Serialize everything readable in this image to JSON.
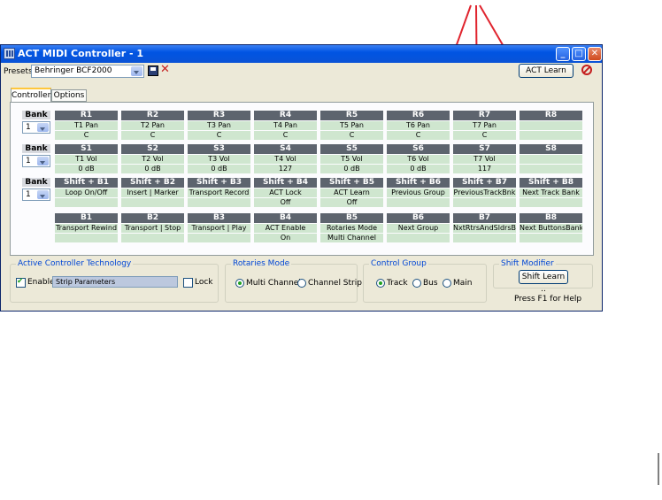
{
  "window": {
    "title": "ACT MIDI Controller - 1"
  },
  "presets": {
    "label": "Presets:",
    "value": "Behringer BCF2000"
  },
  "act_learn_label": "ACT Learn",
  "tabs": [
    "Controllers",
    "Options"
  ],
  "bank_label": "Bank",
  "rows": [
    {
      "bank_value": "1",
      "cells": [
        {
          "head": "R1",
          "l1": "T1 Pan",
          "l2": "C"
        },
        {
          "head": "R2",
          "l1": "T2 Pan",
          "l2": "C"
        },
        {
          "head": "R3",
          "l1": "T3 Pan",
          "l2": "C"
        },
        {
          "head": "R4",
          "l1": "T4 Pan",
          "l2": "C"
        },
        {
          "head": "R5",
          "l1": "T5 Pan",
          "l2": "C"
        },
        {
          "head": "R6",
          "l1": "T6 Pan",
          "l2": "C"
        },
        {
          "head": "R7",
          "l1": "T7 Pan",
          "l2": "C"
        },
        {
          "head": "R8",
          "l1": "",
          "l2": ""
        }
      ]
    },
    {
      "bank_value": "1",
      "cells": [
        {
          "head": "S1",
          "l1": "T1 Vol",
          "l2": "0 dB"
        },
        {
          "head": "S2",
          "l1": "T2 Vol",
          "l2": "0 dB"
        },
        {
          "head": "S3",
          "l1": "T3 Vol",
          "l2": "0 dB"
        },
        {
          "head": "S4",
          "l1": "T4 Vol",
          "l2": "127"
        },
        {
          "head": "S5",
          "l1": "T5 Vol",
          "l2": "0 dB"
        },
        {
          "head": "S6",
          "l1": "T6 Vol",
          "l2": "0 dB"
        },
        {
          "head": "S7",
          "l1": "T7 Vol",
          "l2": "117"
        },
        {
          "head": "S8",
          "l1": "",
          "l2": ""
        }
      ]
    },
    {
      "bank_value": "1",
      "cells": [
        {
          "head": "Shift + B1",
          "l1": "Loop On/Off",
          "l2": ""
        },
        {
          "head": "Shift + B2",
          "l1": "Insert | Marker",
          "l2": ""
        },
        {
          "head": "Shift + B3",
          "l1": "Transport Record",
          "l2": ""
        },
        {
          "head": "Shift + B4",
          "l1": "ACT Lock",
          "l2": "Off"
        },
        {
          "head": "Shift + B5",
          "l1": "ACT Learn",
          "l2": "Off"
        },
        {
          "head": "Shift + B6",
          "l1": "Previous Group",
          "l2": ""
        },
        {
          "head": "Shift + B7",
          "l1": "PreviousTrackBnk",
          "l2": ""
        },
        {
          "head": "Shift + B8",
          "l1": "Next Track Bank",
          "l2": ""
        }
      ]
    },
    {
      "bank_value": null,
      "cells": [
        {
          "head": "B1",
          "l1": "Transport Rewind",
          "l2": ""
        },
        {
          "head": "B2",
          "l1": "Transport | Stop",
          "l2": ""
        },
        {
          "head": "B3",
          "l1": "Transport | Play",
          "l2": ""
        },
        {
          "head": "B4",
          "l1": "ACT Enable",
          "l2": "On"
        },
        {
          "head": "B5",
          "l1": "Rotaries Mode",
          "l2": "Multi Channel"
        },
        {
          "head": "B6",
          "l1": "Next Group",
          "l2": ""
        },
        {
          "head": "B7",
          "l1": "NxtRtrsAndSldrsB",
          "l2": ""
        },
        {
          "head": "B8",
          "l1": "Next ButtonsBank",
          "l2": ""
        }
      ]
    }
  ],
  "act_group": {
    "title": "Active Controller Technology",
    "enable_label": "Enable",
    "enable_checked": true,
    "field_value": "Strip Parameters",
    "lock_label": "Lock"
  },
  "rotaries_group": {
    "title": "Rotaries Mode",
    "options": [
      "Multi Channel",
      "Channel Strip"
    ],
    "selected": 0
  },
  "control_group": {
    "title": "Control Group",
    "options": [
      "Track",
      "Bus",
      "Main"
    ],
    "selected": 0
  },
  "shift_group": {
    "title": "Shift Modifier",
    "button_label": "Shift Learn ..",
    "help": "Press F1 for Help"
  },
  "colors": {
    "accent": "#0054e3",
    "cell_head": "#5d646e",
    "cell_value": "#cfe6cf",
    "annotation": "#e0242e"
  }
}
